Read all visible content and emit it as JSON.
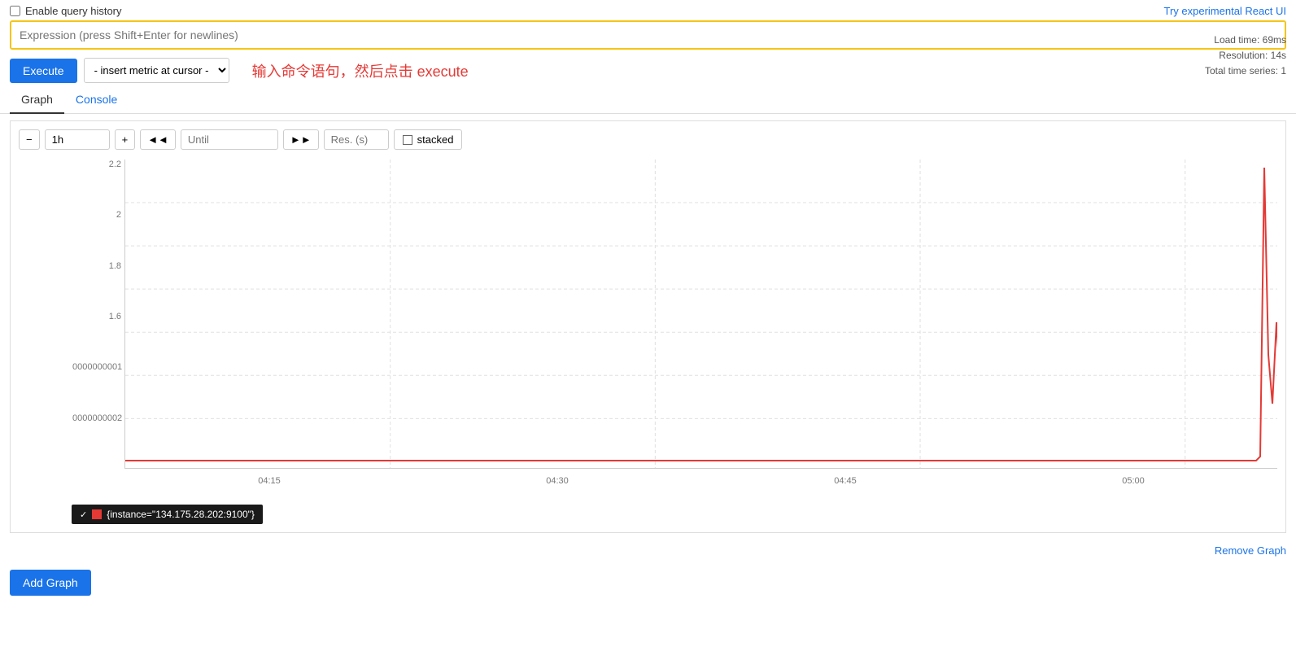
{
  "topbar": {
    "enable_history_label": "Enable query history",
    "try_react_label": "Try experimental React UI"
  },
  "expression": {
    "placeholder": "Expression (press Shift+Enter for newlines)"
  },
  "actions": {
    "execute_label": "Execute",
    "metric_selector_label": "- insert metric at cursor -",
    "instruction": "输入命令语句，然后点击 execute"
  },
  "stats": {
    "load_time": "Load time: 69ms",
    "resolution": "Resolution: 14s",
    "total_series": "Total time series: 1"
  },
  "tabs": {
    "graph_label": "Graph",
    "console_label": "Console"
  },
  "controls": {
    "minus_label": "−",
    "time_value": "1h",
    "plus_label": "+",
    "back_label": "◄◄",
    "until_placeholder": "Until",
    "forward_label": "►►",
    "res_placeholder": "Res. (s)",
    "stacked_label": "stacked"
  },
  "chart": {
    "y_labels": [
      "2.2",
      "2",
      "1.8",
      "1.6",
      "0000000001",
      "0000000002"
    ],
    "x_labels": [
      "04:15",
      "04:30",
      "04:45",
      "05:00"
    ]
  },
  "legend": {
    "checkmark": "✓",
    "series_label": "{instance=\"134.175.28.202:9100\"}"
  },
  "footer": {
    "remove_graph_label": "Remove Graph",
    "add_graph_label": "Add Graph"
  }
}
